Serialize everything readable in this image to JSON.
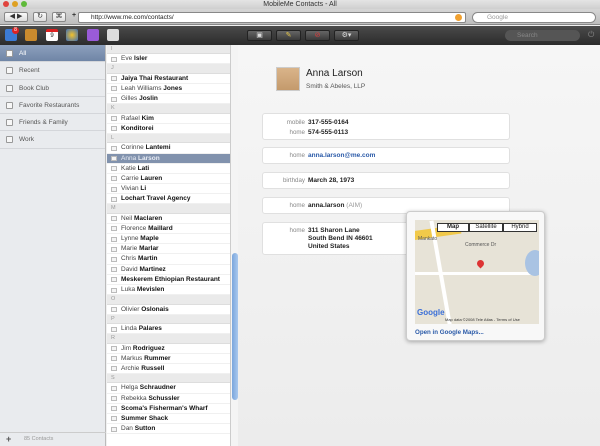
{
  "window": {
    "title": "MobileMe Contacts - All"
  },
  "browser": {
    "url": "http://www.me.com/contacts/",
    "search_placeholder": "Google"
  },
  "appbar": {
    "search_placeholder": "Search",
    "mail_badge": "8",
    "calendar_day": "9"
  },
  "sidebar": {
    "groups": [
      {
        "label": "All"
      },
      {
        "label": "Recent"
      },
      {
        "label": "Book Club"
      },
      {
        "label": "Favorite Restaurants"
      },
      {
        "label": "Friends & Family"
      },
      {
        "label": "Work"
      }
    ],
    "footer": "85 Contacts"
  },
  "list": [
    {
      "header": "I"
    },
    {
      "first": "Eve",
      "last": "Isler"
    },
    {
      "header": "J"
    },
    {
      "company": "Jaiya Thai Restaurant"
    },
    {
      "first": "Leah Williams",
      "last": "Jones"
    },
    {
      "first": "Gilles",
      "last": "Joslin"
    },
    {
      "header": "K"
    },
    {
      "first": "Rafael",
      "last": "Kim"
    },
    {
      "company": "Konditorei"
    },
    {
      "header": "L"
    },
    {
      "first": "Corinne",
      "last": "Lantemi"
    },
    {
      "first": "Anna",
      "last": "Larson",
      "selected": true
    },
    {
      "first": "Katie",
      "last": "Lati"
    },
    {
      "first": "Carrie",
      "last": "Lauren"
    },
    {
      "first": "Vivian",
      "last": "Li"
    },
    {
      "company": "Lochart Travel Agency"
    },
    {
      "header": "M"
    },
    {
      "first": "Neil",
      "last": "Maclaren"
    },
    {
      "first": "Florence",
      "last": "Maillard"
    },
    {
      "first": "Lynne",
      "last": "Maple"
    },
    {
      "first": "Marie",
      "last": "Marlar"
    },
    {
      "first": "Chris",
      "last": "Martin"
    },
    {
      "first": "David",
      "last": "Martinez"
    },
    {
      "company": "Meskerem Ethiopian Restaurant"
    },
    {
      "first": "Luka",
      "last": "Mevislen"
    },
    {
      "header": "O"
    },
    {
      "first": "Olivier",
      "last": "Oslonais"
    },
    {
      "header": "P"
    },
    {
      "first": "Linda",
      "last": "Palares"
    },
    {
      "header": "R"
    },
    {
      "first": "Jim",
      "last": "Rodriguez"
    },
    {
      "first": "Markus",
      "last": "Rummer"
    },
    {
      "first": "Archie",
      "last": "Russell"
    },
    {
      "header": "S"
    },
    {
      "first": "Helga",
      "last": "Schraudner"
    },
    {
      "first": "Rebekka",
      "last": "Schussler"
    },
    {
      "company": "Scoma's Fisherman's Wharf"
    },
    {
      "company": "Summer Shack"
    },
    {
      "first": "Dan",
      "last": "Sutton"
    }
  ],
  "contact": {
    "name": "Anna Larson",
    "company": "Smith & Abeles, LLP",
    "phones": [
      {
        "label": "mobile",
        "value": "317-555-0164"
      },
      {
        "label": "home",
        "value": "574-555-0113"
      }
    ],
    "email": {
      "label": "home",
      "value": "anna.larson@me.com"
    },
    "birthday": {
      "label": "birthday",
      "value": "March 28, 1973"
    },
    "im": {
      "label": "home",
      "value": "anna.larson",
      "service": "(AIM)"
    },
    "address": {
      "label": "home",
      "lines": [
        "311 Sharon Lane",
        "South Bend IN 46601",
        "United States"
      ]
    }
  },
  "map": {
    "tabs": [
      "Map",
      "Satellite",
      "Hybrid"
    ],
    "streets": [
      "Mankato",
      "Commerce Dr"
    ],
    "copyright": "Map data ©2008 Tele Atlas - Terms of Use",
    "google": "Google",
    "open_link": "Open in Google Maps..."
  }
}
